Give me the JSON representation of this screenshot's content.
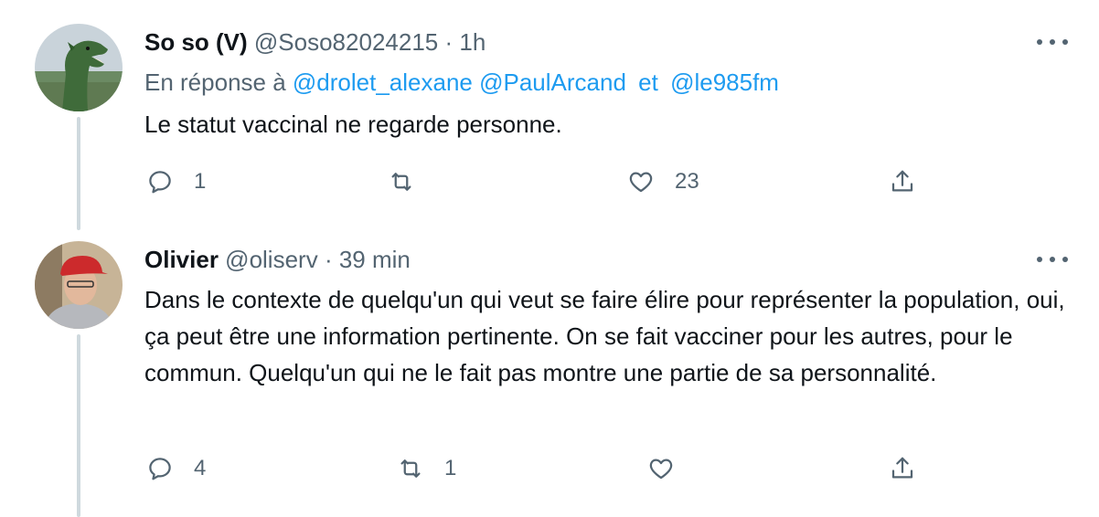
{
  "tweets": [
    {
      "display_name": "So so (V)",
      "handle": "@Soso82024215",
      "separator": "·",
      "time": "1h",
      "reply_prefix": "En réponse à",
      "mention_1": "@drolet_alexane",
      "mention_2": "@PaulArcand",
      "reply_and": "et",
      "mention_3": "@le985fm",
      "text": "Le statut vaccinal ne regarde personne.",
      "replies": "1",
      "retweets": "",
      "likes": "23"
    },
    {
      "display_name": "Olivier",
      "handle": "@oliserv",
      "separator": "·",
      "time": "39 min",
      "text": "Dans le contexte de quelqu'un qui veut se faire élire pour représenter la population, oui, ça peut être une information pertinente. On se fait vacciner pour les autres, pour le commun. Quelqu'un qui ne le fait pas montre une partie de sa personnalité.",
      "replies": "4",
      "retweets": "1",
      "likes": ""
    }
  ],
  "colors": {
    "text": "#0f1419",
    "muted": "#536471",
    "link": "#1d9bf0",
    "thread_line": "#cfd9de"
  },
  "icons": [
    "reply-icon",
    "retweet-icon",
    "like-icon",
    "share-icon",
    "more-icon"
  ]
}
